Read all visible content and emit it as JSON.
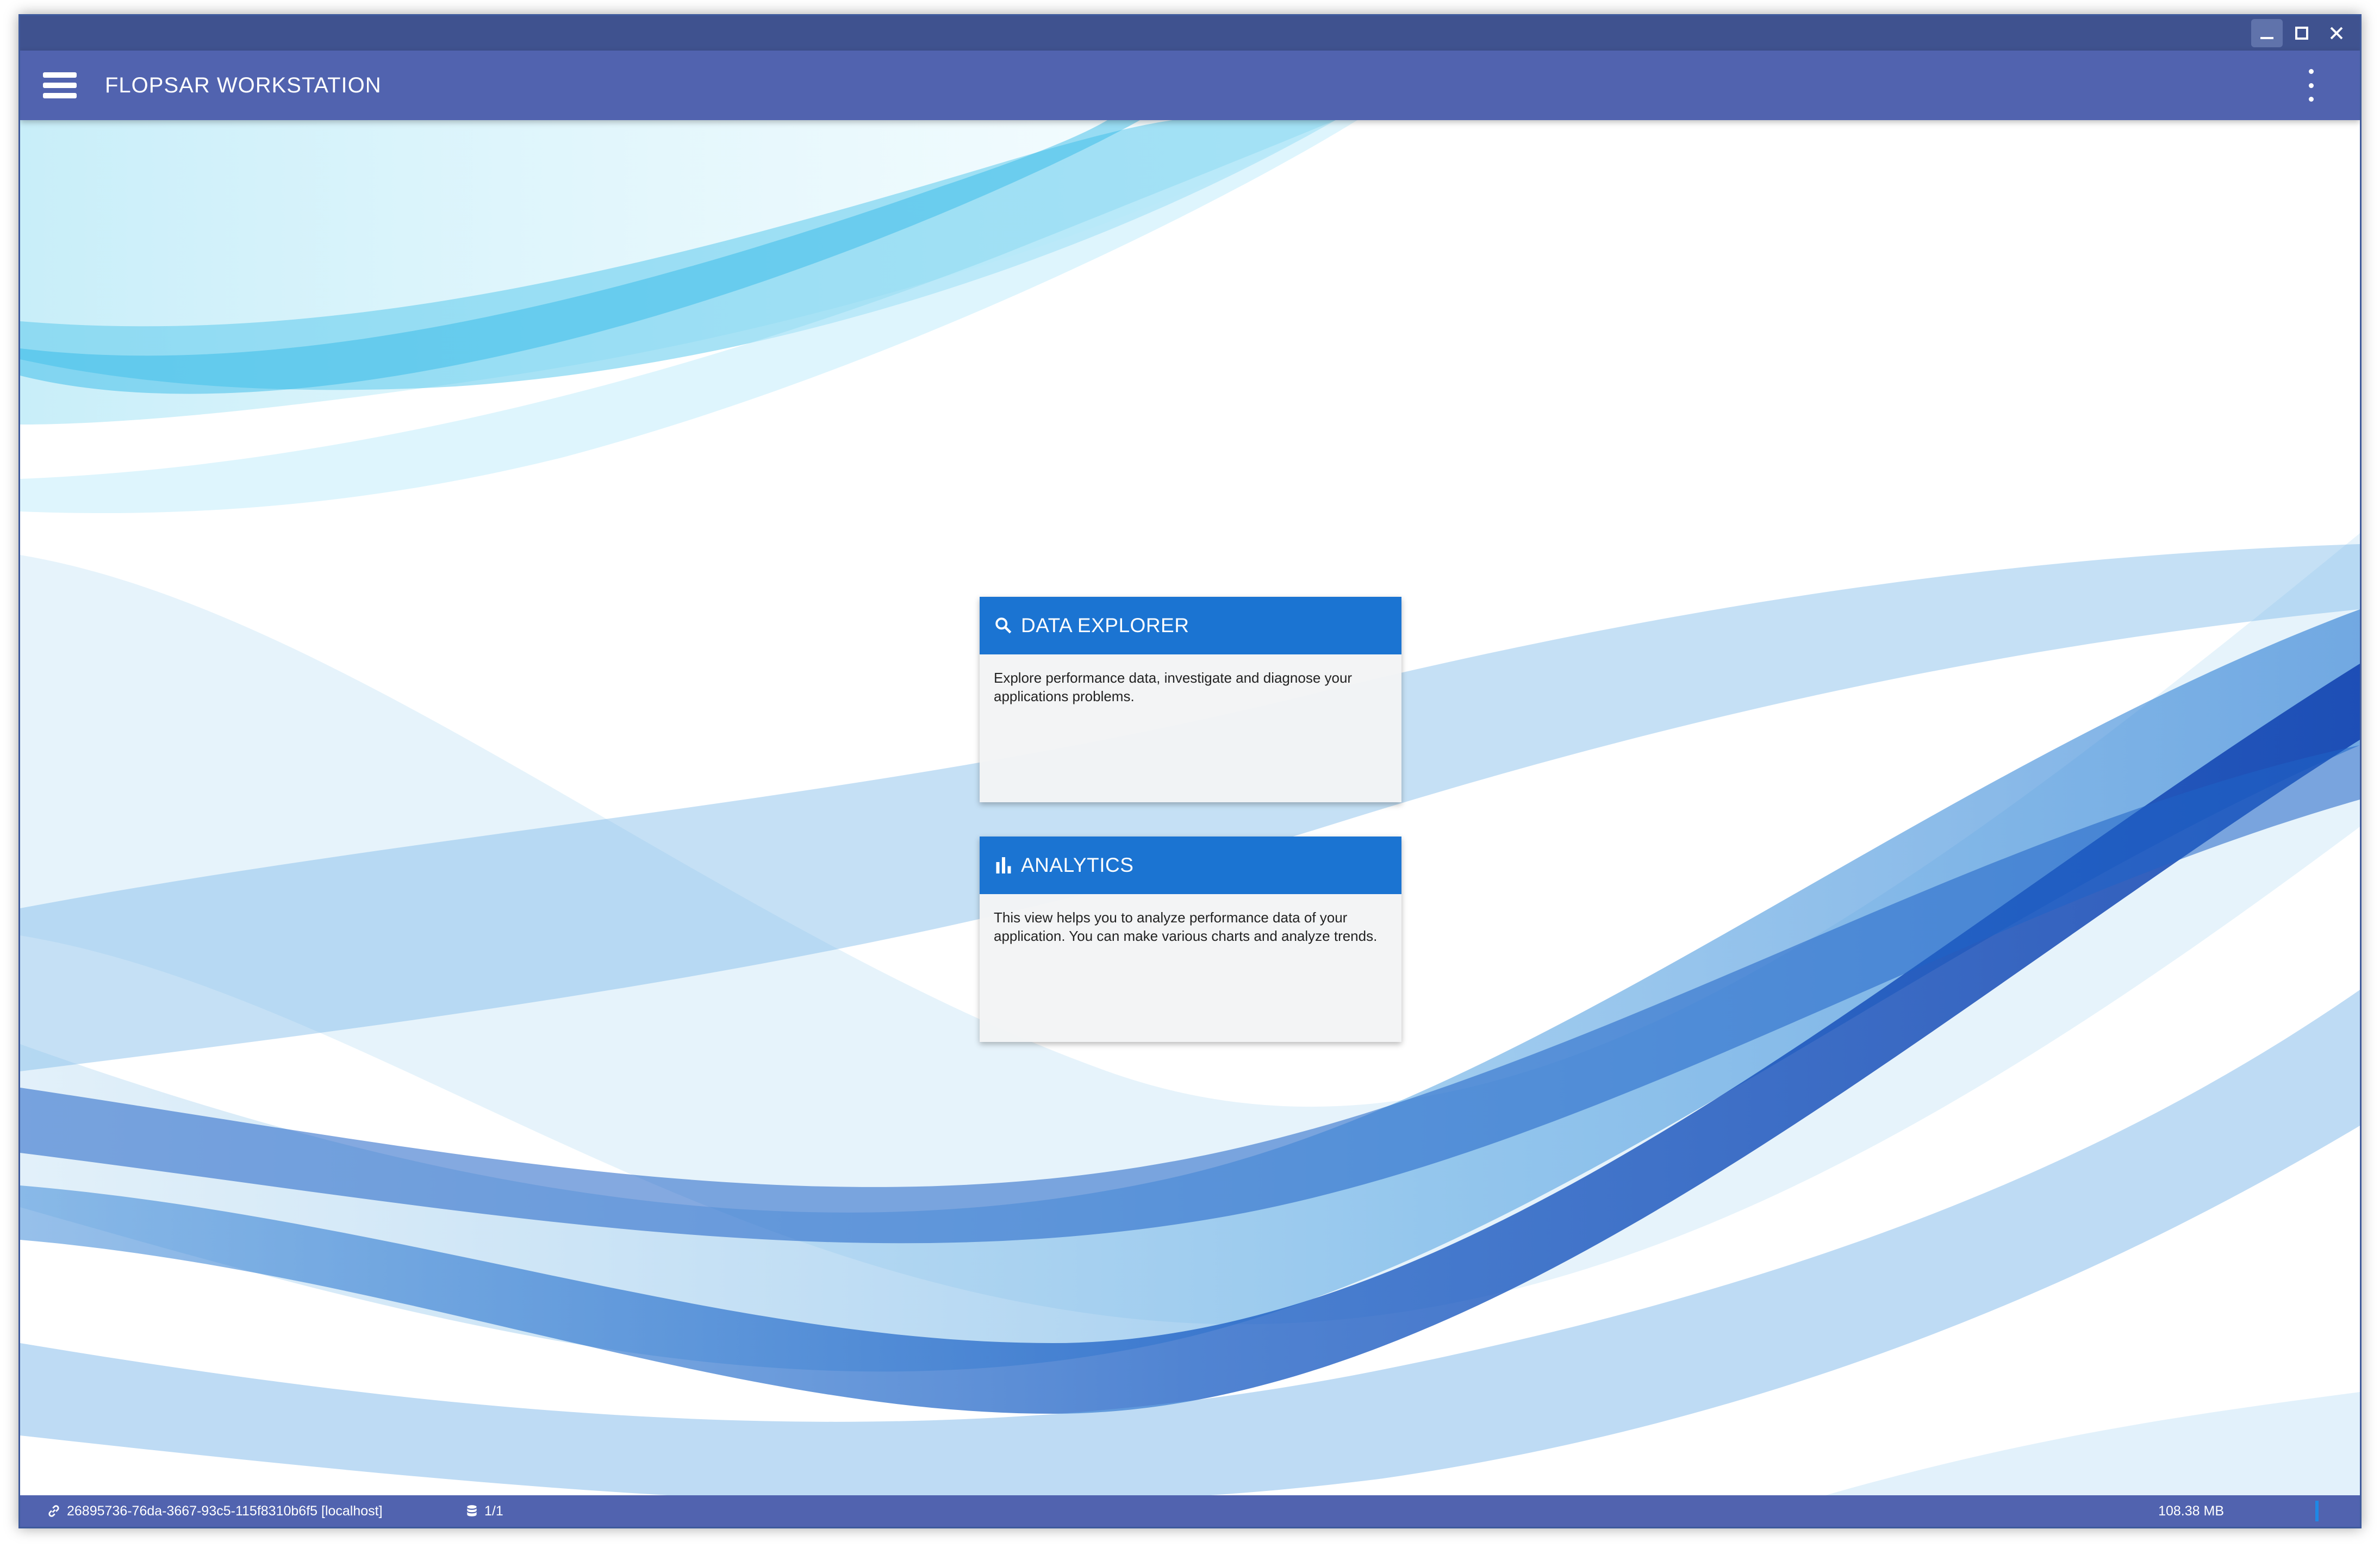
{
  "app": {
    "title": "FLOPSAR WORKSTATION"
  },
  "window_controls": [
    "minimize-icon",
    "maximize-icon",
    "close-icon"
  ],
  "cards": [
    {
      "icon": "search-icon",
      "title": "DATA EXPLORER",
      "description": "Explore performance data, investigate and diagnose your applications problems."
    },
    {
      "icon": "bar-chart-icon",
      "title": "ANALYTICS",
      "description": "This view helps you to analyze performance data of your application. You can make various charts and analyze trends."
    }
  ],
  "status": {
    "connection": "26895736-76da-3667-93c5-115f8310b6f5 [localhost]",
    "databases": "1/1",
    "memory": "108.38 MB"
  },
  "colors": {
    "titlebar": "#3f528f",
    "appbar": "#5163af",
    "card_header": "#1b74d2"
  }
}
